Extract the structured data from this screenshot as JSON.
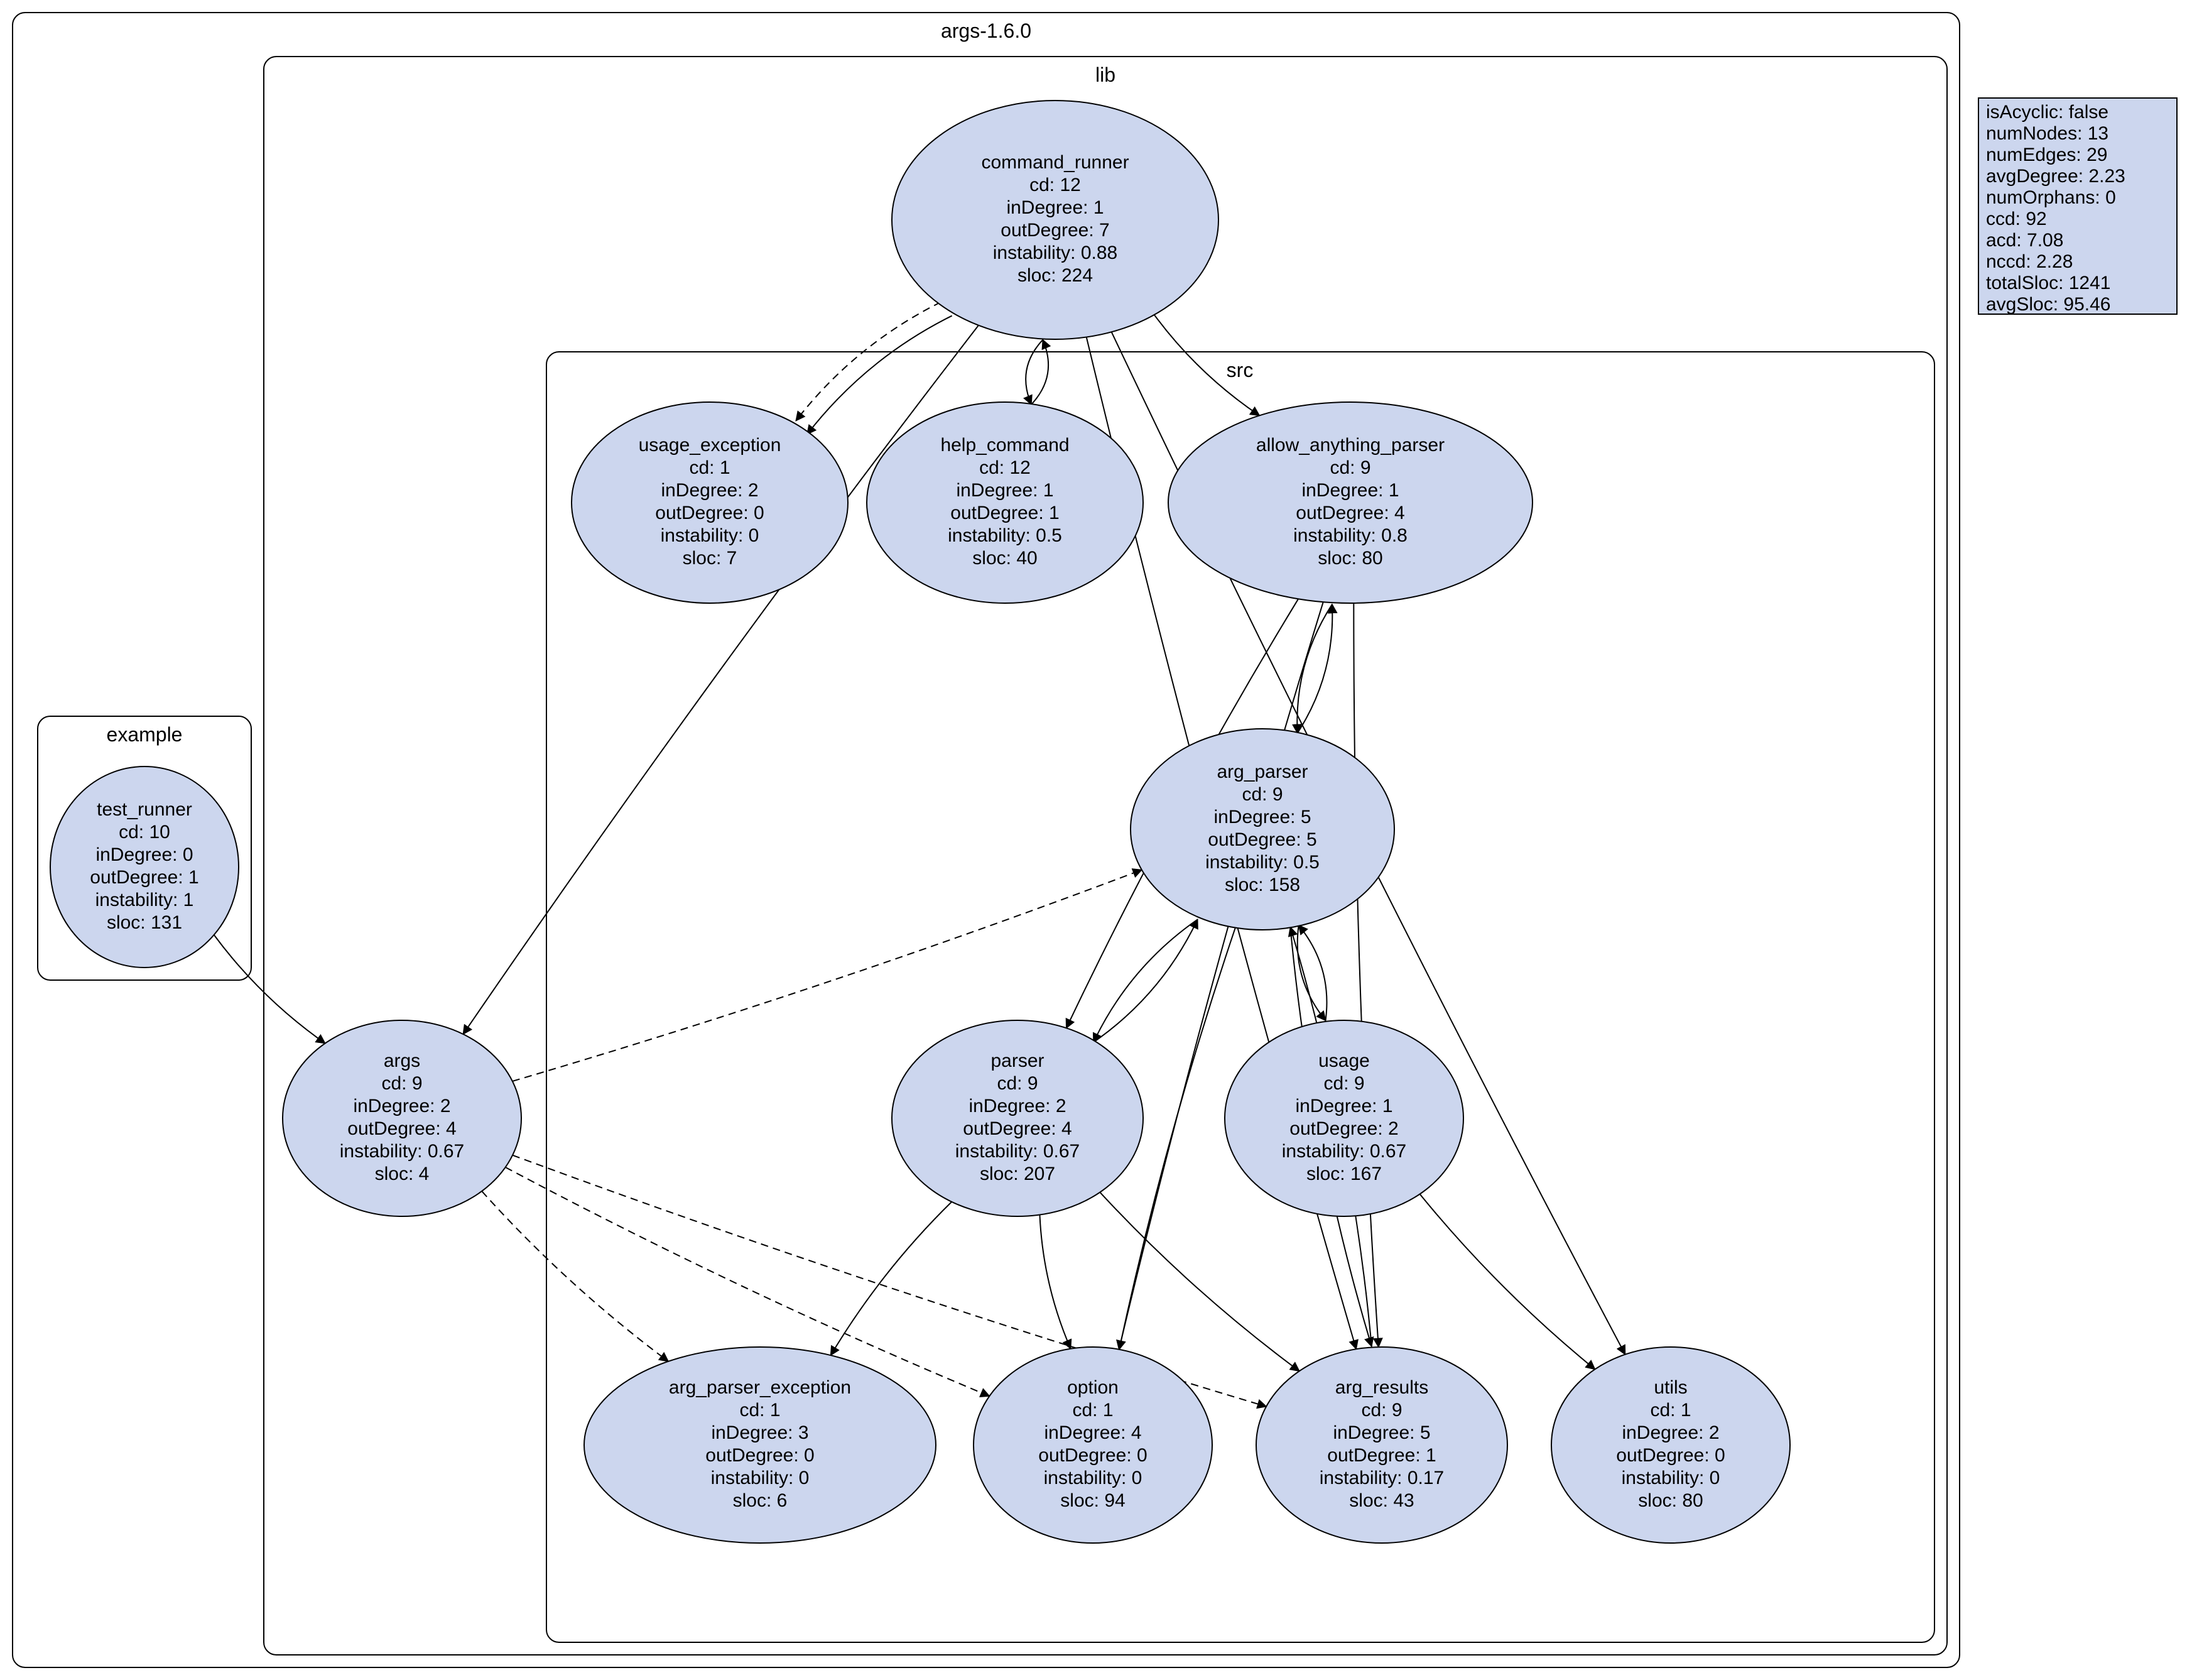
{
  "clusters": {
    "root": {
      "label": "args-1.6.0"
    },
    "lib": {
      "label": "lib"
    },
    "src": {
      "label": "src"
    },
    "example": {
      "label": "example"
    }
  },
  "nodes": {
    "test_runner": {
      "name": "test_runner",
      "cd": 10,
      "inDegree": 0,
      "outDegree": 1,
      "instability": 1.0,
      "sloc": 131
    },
    "command_runner": {
      "name": "command_runner",
      "cd": 12,
      "inDegree": 1,
      "outDegree": 7,
      "instability": 0.88,
      "sloc": 224
    },
    "usage_exception": {
      "name": "usage_exception",
      "cd": 1,
      "inDegree": 2,
      "outDegree": 0,
      "instability": 0.0,
      "sloc": 7
    },
    "help_command": {
      "name": "help_command",
      "cd": 12,
      "inDegree": 1,
      "outDegree": 1,
      "instability": 0.5,
      "sloc": 40
    },
    "allow_anything_parser": {
      "name": "allow_anything_parser",
      "cd": 9,
      "inDegree": 1,
      "outDegree": 4,
      "instability": 0.8,
      "sloc": 80
    },
    "arg_parser": {
      "name": "arg_parser",
      "cd": 9,
      "inDegree": 5,
      "outDegree": 5,
      "instability": 0.5,
      "sloc": 158
    },
    "args": {
      "name": "args",
      "cd": 9,
      "inDegree": 2,
      "outDegree": 4,
      "instability": 0.67,
      "sloc": 4
    },
    "parser": {
      "name": "parser",
      "cd": 9,
      "inDegree": 2,
      "outDegree": 4,
      "instability": 0.67,
      "sloc": 207
    },
    "usage": {
      "name": "usage",
      "cd": 9,
      "inDegree": 1,
      "outDegree": 2,
      "instability": 0.67,
      "sloc": 167
    },
    "arg_parser_exception": {
      "name": "arg_parser_exception",
      "cd": 1,
      "inDegree": 3,
      "outDegree": 0,
      "instability": 0.0,
      "sloc": 6
    },
    "option": {
      "name": "option",
      "cd": 1,
      "inDegree": 4,
      "outDegree": 0,
      "instability": 0.0,
      "sloc": 94
    },
    "arg_results": {
      "name": "arg_results",
      "cd": 9,
      "inDegree": 5,
      "outDegree": 1,
      "instability": 0.17,
      "sloc": 43
    },
    "utils": {
      "name": "utils",
      "cd": 1,
      "inDegree": 2,
      "outDegree": 0,
      "instability": 0.0,
      "sloc": 80
    }
  },
  "edges": [
    {
      "from": "test_runner",
      "to": "args",
      "dashed": false
    },
    {
      "from": "command_runner",
      "to": "usage_exception",
      "dashed": false
    },
    {
      "from": "command_runner",
      "to": "usage_exception",
      "dashed": true
    },
    {
      "from": "command_runner",
      "to": "help_command",
      "dashed": false
    },
    {
      "from": "help_command",
      "to": "command_runner",
      "dashed": false
    },
    {
      "from": "command_runner",
      "to": "allow_anything_parser",
      "dashed": false
    },
    {
      "from": "command_runner",
      "to": "args",
      "dashed": false
    },
    {
      "from": "command_runner",
      "to": "arg_results",
      "dashed": false
    },
    {
      "from": "command_runner",
      "to": "utils",
      "dashed": false
    },
    {
      "from": "allow_anything_parser",
      "to": "arg_parser",
      "dashed": false
    },
    {
      "from": "arg_parser",
      "to": "allow_anything_parser",
      "dashed": false
    },
    {
      "from": "allow_anything_parser",
      "to": "parser",
      "dashed": false
    },
    {
      "from": "allow_anything_parser",
      "to": "option",
      "dashed": false
    },
    {
      "from": "allow_anything_parser",
      "to": "arg_results",
      "dashed": false
    },
    {
      "from": "arg_parser",
      "to": "parser",
      "dashed": false
    },
    {
      "from": "parser",
      "to": "arg_parser",
      "dashed": false
    },
    {
      "from": "arg_parser",
      "to": "usage",
      "dashed": false
    },
    {
      "from": "usage",
      "to": "arg_parser",
      "dashed": false
    },
    {
      "from": "arg_parser",
      "to": "option",
      "dashed": false
    },
    {
      "from": "arg_parser",
      "to": "arg_results",
      "dashed": false
    },
    {
      "from": "arg_results",
      "to": "arg_parser",
      "dashed": false
    },
    {
      "from": "args",
      "to": "arg_parser",
      "dashed": true
    },
    {
      "from": "args",
      "to": "arg_parser_exception",
      "dashed": true
    },
    {
      "from": "args",
      "to": "option",
      "dashed": true
    },
    {
      "from": "args",
      "to": "arg_results",
      "dashed": true
    },
    {
      "from": "parser",
      "to": "arg_parser_exception",
      "dashed": false
    },
    {
      "from": "parser",
      "to": "option",
      "dashed": false
    },
    {
      "from": "parser",
      "to": "arg_results",
      "dashed": false
    },
    {
      "from": "usage",
      "to": "utils",
      "dashed": false
    }
  ],
  "info": {
    "isAcyclic": "false",
    "numNodes": 13,
    "numEdges": 29,
    "avgDegree": 2.23,
    "numOrphans": 0,
    "ccd": 92,
    "acd": 7.08,
    "nccd": 2.28,
    "totalSloc": 1241,
    "avgSloc": 95.46
  },
  "labels": {
    "cd": "cd",
    "inDegree": "inDegree",
    "outDegree": "outDegree",
    "instability": "instability",
    "sloc": "sloc",
    "isAcyclic": "isAcyclic",
    "numNodes": "numNodes",
    "numEdges": "numEdges",
    "avgDegree": "avgDegree",
    "numOrphans": "numOrphans",
    "ccd": "ccd",
    "acd": "acd",
    "nccd": "nccd",
    "totalSloc": "totalSloc",
    "avgSloc": "avgSloc"
  }
}
